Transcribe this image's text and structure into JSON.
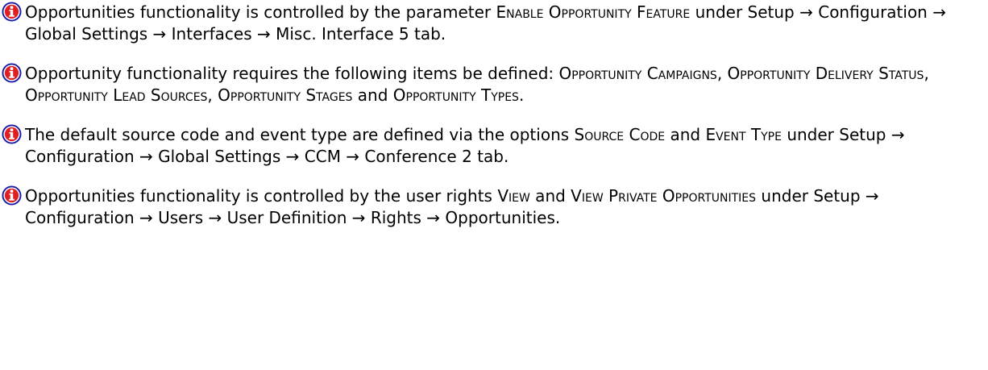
{
  "icon_name": "info-icon",
  "icon_colors": {
    "outer_ring": "#1a1aa8",
    "ring": "#ffffff",
    "fill": "#e02020",
    "glyph": "#ffffff"
  },
  "notes": [
    {
      "t1": "Opportunities functionality is controlled by the parameter ",
      "sc1": "Enable Opportunity Feature",
      "t2": " under Setup → Configuration → Global Settings → Interfaces → Misc. Interface 5 tab."
    },
    {
      "t1": "Opportunity functionality requires the following items be defined: ",
      "sc1": "Opportunity Campaigns",
      "t2": ", ",
      "sc2": "Opportunity Delivery Status",
      "t3": ", ",
      "sc3": "Opportunity Lead Sources",
      "t4": ", ",
      "sc4": "Opportunity Stages",
      "t5": " and ",
      "sc5": "Opportunity Types",
      "t6": "."
    },
    {
      "t1": "The default source code and event type are defined via the options ",
      "sc1": "Source Code",
      "t2": " and ",
      "sc2": "Event Type",
      "t3": " under Setup → Configuration → Global Settings → CCM → Conference 2 tab."
    },
    {
      "t1": "Opportunities functionality is controlled by the user rights ",
      "sc1": "View",
      "t2": " and ",
      "sc2": "View Private Opportunities",
      "t3": " under Setup → Configuration → Users → User Definition → Rights → Opportunities."
    }
  ]
}
